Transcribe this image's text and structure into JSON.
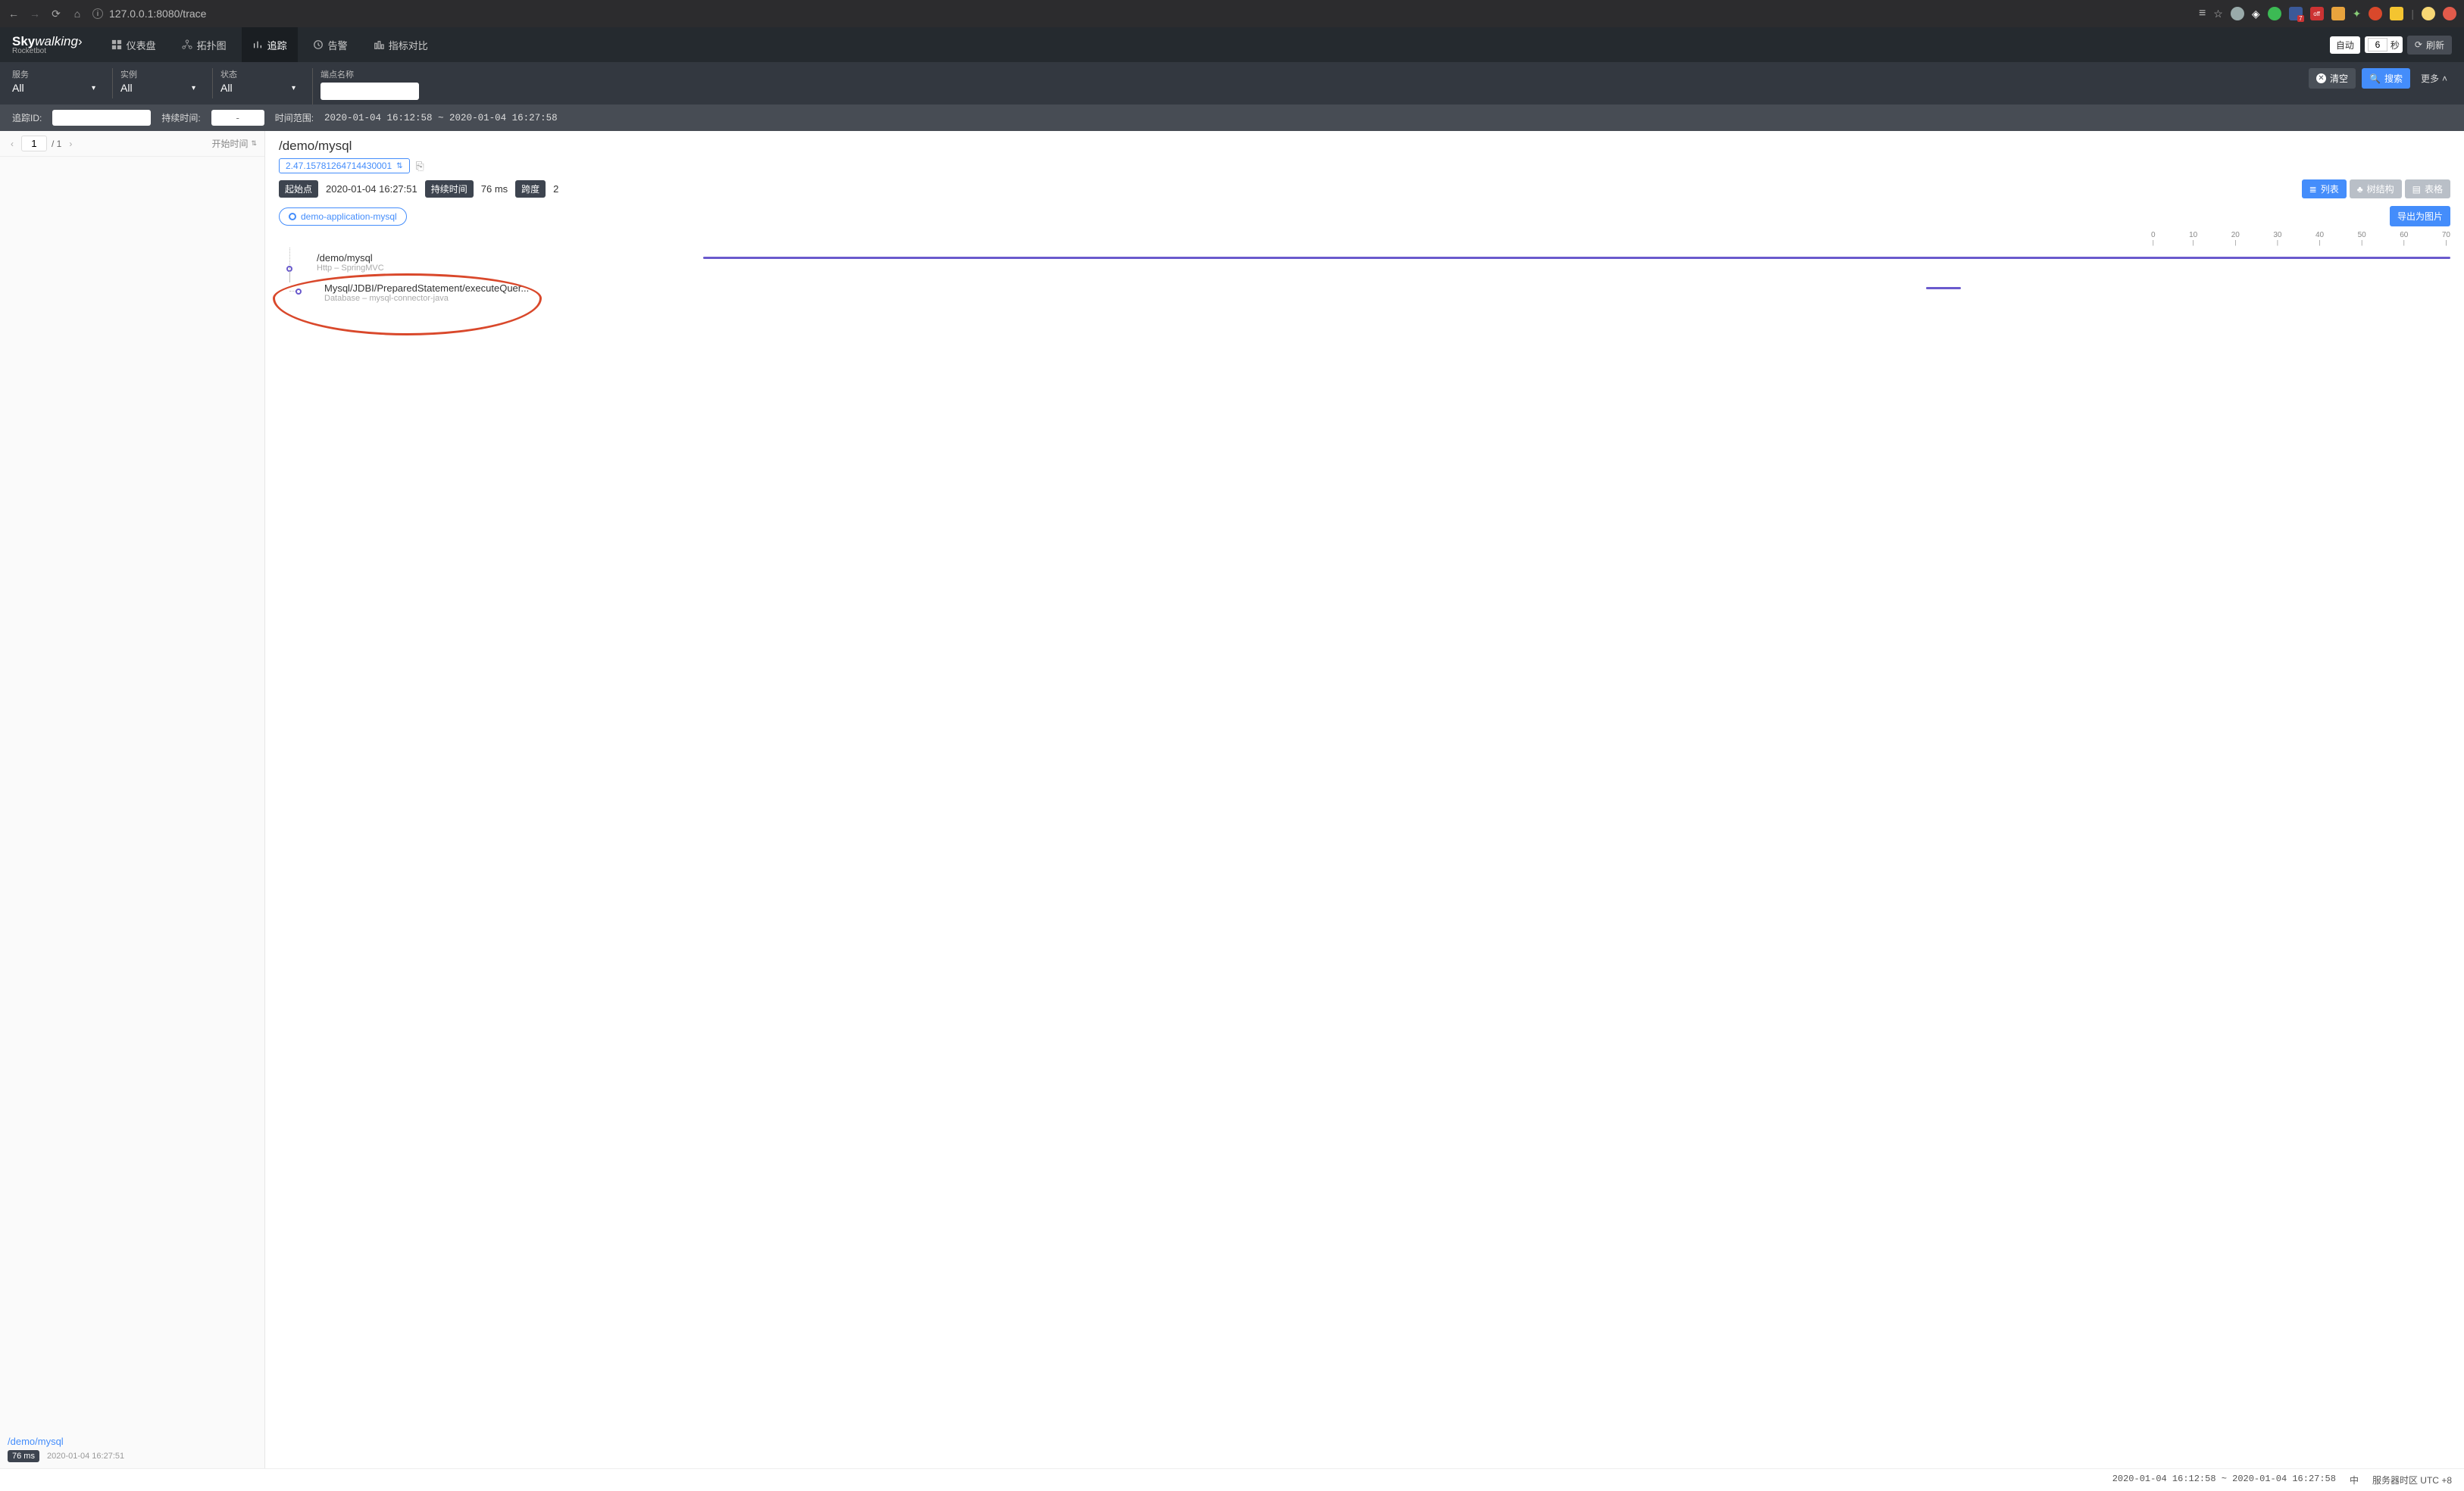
{
  "browser": {
    "url": "127.0.0.1:8080/trace"
  },
  "brand": {
    "name_a": "Sky",
    "name_b": "walking",
    "sub": "Rocketbot"
  },
  "nav": {
    "items": [
      {
        "label": "仪表盘"
      },
      {
        "label": "拓扑图"
      },
      {
        "label": "追踪"
      },
      {
        "label": "告警"
      },
      {
        "label": "指标对比"
      }
    ],
    "auto": "自动",
    "interval_value": "6",
    "interval_unit": "秒",
    "refresh": "刷新"
  },
  "filters": {
    "service": {
      "label": "服务",
      "value": "All"
    },
    "instance": {
      "label": "实例",
      "value": "All"
    },
    "status": {
      "label": "状态",
      "value": "All"
    },
    "endpoint": {
      "label": "端点名称",
      "value": ""
    },
    "clear": "清空",
    "search": "搜索",
    "more": "更多"
  },
  "filters2": {
    "trace_id_label": "追踪ID:",
    "trace_id_value": "",
    "duration_label": "持续时间:",
    "duration_placeholder": "-",
    "time_range_label": "时间范围:",
    "time_range_value": "2020-01-04 16:12:58 ~ 2020-01-04 16:27:58"
  },
  "left": {
    "page": "1",
    "total": "/ 1",
    "sort": "开始时间",
    "trace": {
      "name": "/demo/mysql",
      "duration": "76 ms",
      "time": "2020-01-04 16:27:51"
    }
  },
  "right": {
    "title": "/demo/mysql",
    "trace_id": "2.47.15781264714430001",
    "start_label": "起始点",
    "start_value": "2020-01-04 16:27:51",
    "dur_label": "持续时间",
    "dur_value": "76 ms",
    "spans_label": "跨度",
    "spans_value": "2",
    "views": {
      "list": "列表",
      "tree": "树结构",
      "table": "表格"
    },
    "app": "demo-application-mysql",
    "export": "导出为图片",
    "axis": [
      "0",
      "10",
      "20",
      "30",
      "40",
      "50",
      "60",
      "70"
    ],
    "spans": [
      {
        "name": "/demo/mysql",
        "sub": "Http – SpringMVC"
      },
      {
        "name": "Mysql/JDBI/PreparedStatement/executeQuer...",
        "sub": "Database – mysql-connector-java"
      }
    ]
  },
  "footer": {
    "range": "2020-01-04 16:12:58 ~ 2020-01-04 16:27:58",
    "locale": "中",
    "tz_label": "服务器时区 UTC",
    "tz_value": "+8"
  }
}
